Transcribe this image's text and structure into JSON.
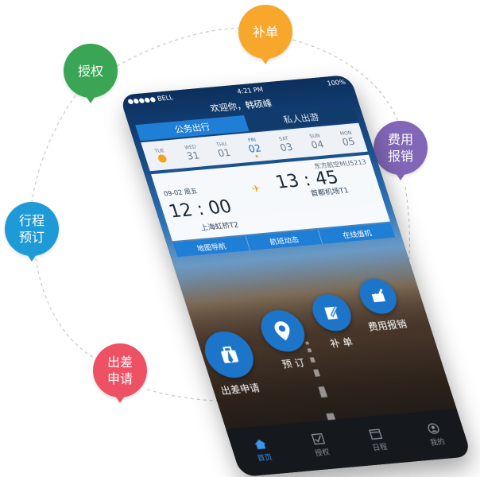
{
  "bubbles": [
    {
      "label": "补单",
      "color": "#f7a82c"
    },
    {
      "label": "授权",
      "color": "#3aa655"
    },
    {
      "label": "费用\n报销",
      "color": "#8266b7"
    },
    {
      "label": "行程\n预订",
      "color": "#1e9ad6"
    },
    {
      "label": "出差\n申请",
      "color": "#ee5064"
    }
  ],
  "status": {
    "carrier": "●●●●● BELL",
    "time": "4:21 PM",
    "battery": "100%"
  },
  "welcome": "欢迎你，韩硕峰",
  "tabs": {
    "business": "公务出行",
    "private": "私人出游"
  },
  "days": [
    {
      "name": "TUE",
      "date": "",
      "today": true
    },
    {
      "name": "WED",
      "date": "31"
    },
    {
      "name": "THU",
      "date": "01"
    },
    {
      "name": "FRI",
      "date": "02",
      "selected": true
    },
    {
      "name": "SAT",
      "date": "03"
    },
    {
      "name": "SUN",
      "date": "04"
    },
    {
      "name": "MON",
      "date": "05"
    }
  ],
  "flight": {
    "airline": "东方航空MU5213",
    "date": "09-02 周五",
    "depart_time": "12 : 00",
    "arrive_time": "13 : 45",
    "depart_airport": "上海虹桥T2",
    "arrive_airport": "首都机场T1"
  },
  "card_actions": {
    "map": "地图导航",
    "status": "航班动态",
    "checkin": "在线值机"
  },
  "actions": {
    "apply": "出差申请",
    "book": "预 订",
    "supplement": "补 单",
    "expense": "费用报销"
  },
  "tabbar": {
    "home": "首页",
    "auth": "授权",
    "schedule": "日程",
    "mine": "我的"
  },
  "colors": {
    "accent": "#1f7ed6",
    "tab_active": "#3a95f0"
  }
}
